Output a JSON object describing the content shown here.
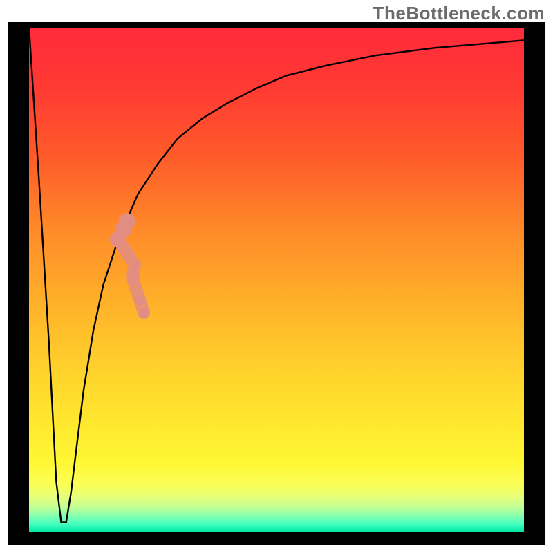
{
  "attribution": "TheBottleneck.com",
  "colors": {
    "frame": "#000000",
    "curve": "#000000",
    "marker": "#e28d84",
    "gradient_stops": [
      {
        "offset": 0.0,
        "color": "#ff2a3a"
      },
      {
        "offset": 0.12,
        "color": "#ff3a33"
      },
      {
        "offset": 0.25,
        "color": "#ff5a2a"
      },
      {
        "offset": 0.4,
        "color": "#ff8a29"
      },
      {
        "offset": 0.55,
        "color": "#ffb229"
      },
      {
        "offset": 0.68,
        "color": "#ffd22c"
      },
      {
        "offset": 0.78,
        "color": "#ffe72e"
      },
      {
        "offset": 0.86,
        "color": "#fff733"
      },
      {
        "offset": 0.905,
        "color": "#faff55"
      },
      {
        "offset": 0.93,
        "color": "#e6ff7a"
      },
      {
        "offset": 0.952,
        "color": "#beff98"
      },
      {
        "offset": 0.97,
        "color": "#7dffb3"
      },
      {
        "offset": 0.985,
        "color": "#3dffc0"
      },
      {
        "offset": 1.0,
        "color": "#00e4a0"
      }
    ]
  },
  "chart_data": {
    "type": "line",
    "title": "",
    "xlabel": "",
    "ylabel": "",
    "xlim": [
      0,
      100
    ],
    "ylim": [
      0,
      100
    ],
    "grid": false,
    "legend": false,
    "series": [
      {
        "name": "bottleneck-curve",
        "x": [
          0,
          2,
          4,
          5.5,
          6.5,
          7.5,
          8.5,
          9.5,
          11,
          13,
          15,
          18,
          22,
          26,
          30,
          35,
          40,
          46,
          52,
          60,
          70,
          82,
          100
        ],
        "y": [
          100,
          70,
          38,
          10,
          2,
          2,
          8,
          16,
          28,
          40,
          49,
          58,
          67,
          73,
          78,
          82,
          85,
          88,
          90.5,
          92.5,
          94.5,
          96,
          97.5
        ]
      }
    ],
    "markers": {
      "name": "highlight-points",
      "points": [
        {
          "x": 18.0,
          "y": 58.0,
          "r": 2.4
        },
        {
          "x": 19.0,
          "y": 60.0,
          "r": 2.4
        },
        {
          "x": 19.8,
          "y": 61.6,
          "r": 2.4
        },
        {
          "x": 21.0,
          "y": 50.0,
          "r": 1.2
        },
        {
          "x": 21.0,
          "y": 51.5,
          "r": 1.2
        },
        {
          "x": 21.4,
          "y": 53.0,
          "r": 1.2
        },
        {
          "x": 22.4,
          "y": 46.0,
          "r": 1.4
        },
        {
          "x": 23.2,
          "y": 43.5,
          "r": 1.4
        }
      ]
    },
    "background_gradient": "vertical red→orange→yellow→green inside plot frame"
  }
}
